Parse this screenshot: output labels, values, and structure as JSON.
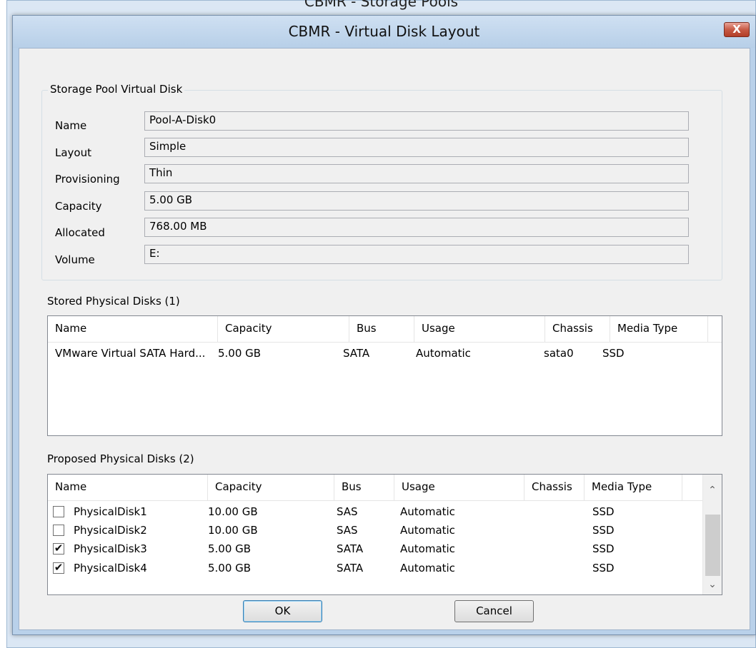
{
  "parent_window": {
    "title": "CBMR - Storage Pools"
  },
  "dialog": {
    "title": "CBMR - Virtual Disk Layout",
    "close_label": "X"
  },
  "virtual_disk": {
    "group_title": "Storage Pool Virtual Disk",
    "fields": [
      {
        "label": "Name",
        "value": "Pool-A-Disk0"
      },
      {
        "label": "Layout",
        "value": "Simple"
      },
      {
        "label": "Provisioning",
        "value": "Thin"
      },
      {
        "label": "Capacity",
        "value": "5.00 GB"
      },
      {
        "label": "Allocated",
        "value": "768.00 MB"
      },
      {
        "label": "Volume",
        "value": "E:"
      }
    ]
  },
  "stored_disks": {
    "label": "Stored Physical Disks (1)",
    "columns": [
      "Name",
      "Capacity",
      "Bus",
      "Usage",
      "Chassis",
      "Media Type"
    ],
    "rows": [
      {
        "name": "VMware Virtual SATA Hard...",
        "capacity": "5.00 GB",
        "bus": "SATA",
        "usage": "Automatic",
        "chassis": "sata0",
        "media": "SSD"
      }
    ]
  },
  "proposed_disks": {
    "label": "Proposed Physical Disks (2)",
    "columns": [
      "Name",
      "Capacity",
      "Bus",
      "Usage",
      "Chassis",
      "Media Type"
    ],
    "rows": [
      {
        "checked": false,
        "name": "PhysicalDisk1",
        "capacity": "10.00 GB",
        "bus": "SAS",
        "usage": "Automatic",
        "chassis": "",
        "media": "SSD"
      },
      {
        "checked": false,
        "name": "PhysicalDisk2",
        "capacity": "10.00 GB",
        "bus": "SAS",
        "usage": "Automatic",
        "chassis": "",
        "media": "SSD"
      },
      {
        "checked": true,
        "name": "PhysicalDisk3",
        "capacity": "5.00 GB",
        "bus": "SATA",
        "usage": "Automatic",
        "chassis": "",
        "media": "SSD"
      },
      {
        "checked": true,
        "name": "PhysicalDisk4",
        "capacity": "5.00 GB",
        "bus": "SATA",
        "usage": "Automatic",
        "chassis": "",
        "media": "SSD"
      }
    ],
    "scroll_up_icon": "chevron-up-icon",
    "scroll_down_icon": "chevron-down-icon"
  },
  "buttons": {
    "ok": "OK",
    "cancel": "Cancel"
  }
}
